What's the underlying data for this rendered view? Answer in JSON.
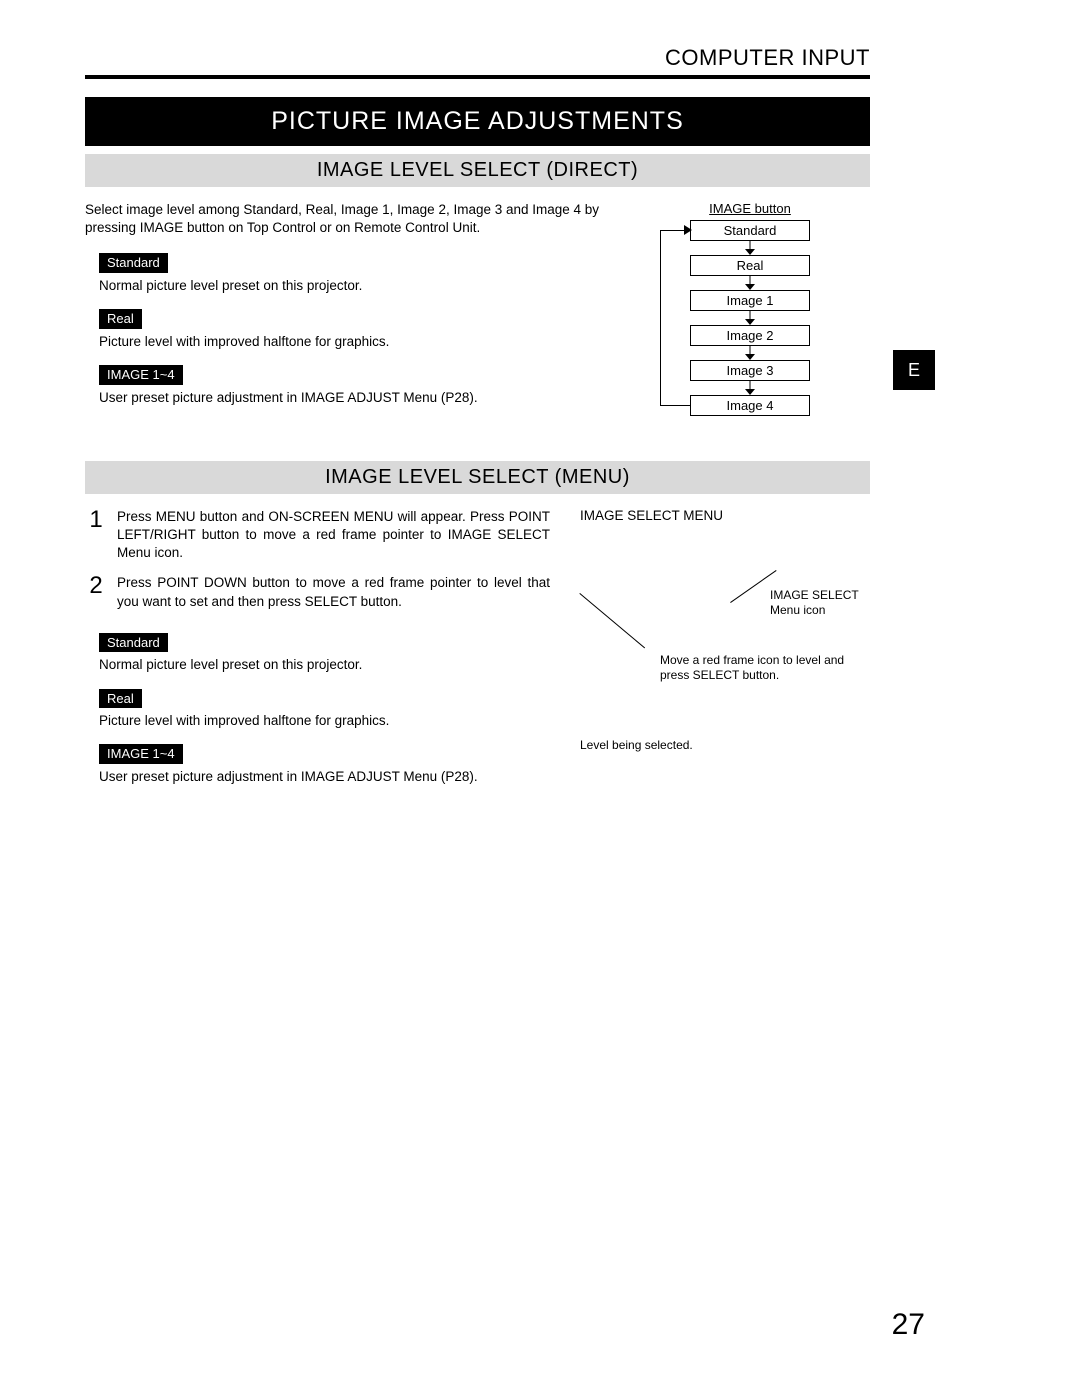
{
  "header": {
    "title": "COMPUTER INPUT"
  },
  "main_title": "PICTURE IMAGE ADJUSTMENTS",
  "side_tab": "E",
  "page_number": "27",
  "section1": {
    "title": "IMAGE LEVEL SELECT (DIRECT)",
    "intro": "Select image level among Standard, Real, Image 1, Image 2, Image 3 and Image 4 by pressing IMAGE button on Top Control or on Remote Control Unit.",
    "items": [
      {
        "label": "Standard",
        "desc": "Normal picture level preset on this projector."
      },
      {
        "label": "Real",
        "desc": "Picture level with improved halftone for graphics."
      },
      {
        "label": "IMAGE 1~4",
        "desc": "User preset picture adjustment in IMAGE ADJUST Menu (P28)."
      }
    ],
    "diagram": {
      "button_label": "IMAGE button",
      "boxes": [
        "Standard",
        "Real",
        "Image 1",
        "Image 2",
        "Image 3",
        "Image 4"
      ]
    }
  },
  "section2": {
    "title": "IMAGE LEVEL SELECT (MENU)",
    "steps": [
      {
        "num": "1",
        "text": "Press MENU button and ON-SCREEN MENU will appear.  Press POINT LEFT/RIGHT button to move a red frame pointer to IMAGE SELECT Menu icon."
      },
      {
        "num": "2",
        "text": "Press POINT DOWN button to move a red frame pointer to level that you want to set and then press SELECT button."
      }
    ],
    "items": [
      {
        "label": "Standard",
        "desc": "Normal picture level preset on this projector."
      },
      {
        "label": "Real",
        "desc": "Picture level with improved halftone for graphics."
      },
      {
        "label": "IMAGE 1~4",
        "desc": "User preset picture adjustment in IMAGE ADJUST Menu (P28)."
      }
    ],
    "diagram": {
      "menu_title": "IMAGE SELECT MENU",
      "callout_icon": "IMAGE SELECT Menu icon",
      "callout_move": "Move a red frame icon to level and press SELECT button.",
      "callout_selected": "Level being selected."
    }
  }
}
